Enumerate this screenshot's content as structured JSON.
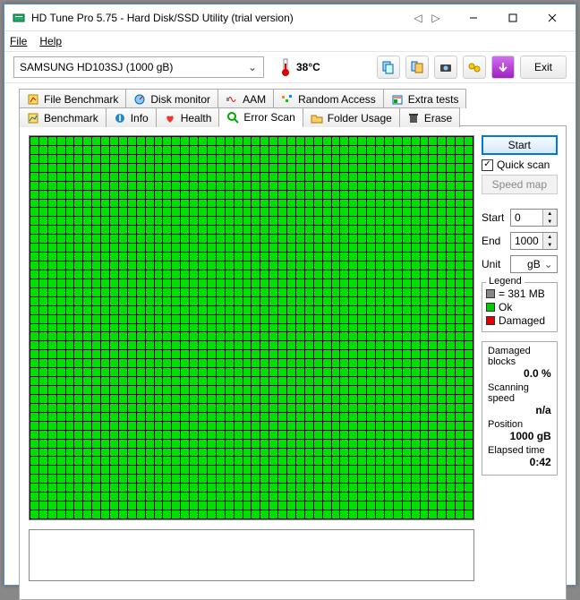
{
  "window": {
    "title": "HD Tune Pro 5.75 - Hard Disk/SSD Utility (trial version)"
  },
  "menu": {
    "file": "File",
    "help": "Help"
  },
  "toolbar": {
    "drive": "SAMSUNG HD103SJ (1000 gB)",
    "temp": "38°C",
    "exit": "Exit"
  },
  "tabs": {
    "row1": [
      "File Benchmark",
      "Disk monitor",
      "AAM",
      "Random Access",
      "Extra tests"
    ],
    "row2": [
      "Benchmark",
      "Info",
      "Health",
      "Error Scan",
      "Folder Usage",
      "Erase"
    ],
    "active": "Error Scan"
  },
  "side": {
    "start": "Start",
    "quick_scan": "Quick scan",
    "quick_scan_checked": true,
    "speedmap": "Speed map",
    "start_label": "Start",
    "start_val": "0",
    "end_label": "End",
    "end_val": "1000",
    "unit_label": "Unit",
    "unit_val": "gB"
  },
  "legend": {
    "title": "Legend",
    "block": "= 381 MB",
    "ok": "Ok",
    "damaged": "Damaged"
  },
  "stats": {
    "damaged_lbl": "Damaged blocks",
    "damaged_val": "0.0 %",
    "speed_lbl": "Scanning speed",
    "speed_val": "n/a",
    "pos_lbl": "Position",
    "pos_val": "1000 gB",
    "elapsed_lbl": "Elapsed time",
    "elapsed_val": "0:42"
  }
}
